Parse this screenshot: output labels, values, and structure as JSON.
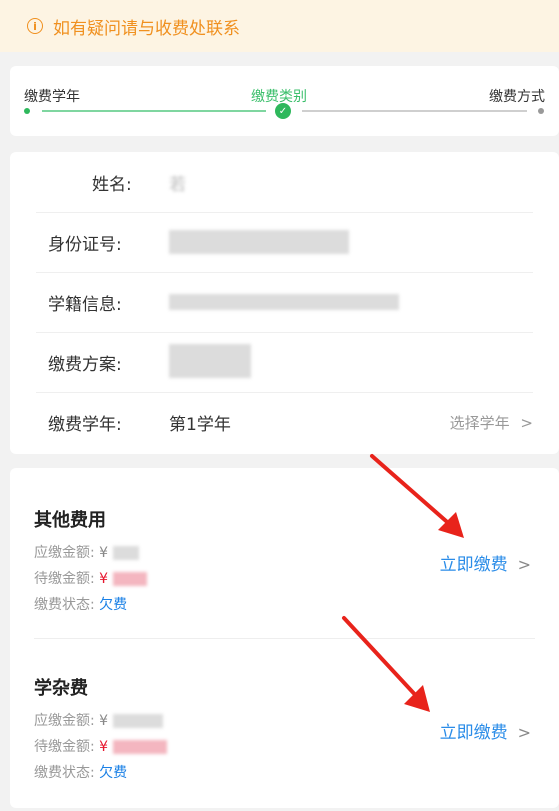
{
  "notice": {
    "icon": "info-icon",
    "text": "如有疑问请与收费处联系",
    "color": "#f0901f"
  },
  "steps": [
    {
      "label": "缴费学年"
    },
    {
      "label": "缴费类别",
      "active": true
    },
    {
      "label": "缴费方式"
    }
  ],
  "student": {
    "name_label": "姓名:",
    "name_value": "若",
    "id_label": "身份证号:",
    "status_label": "学籍信息:",
    "plan_label": "缴费方案:",
    "year_label": "缴费学年:",
    "year_value": "第1学年",
    "select_year": "选择学年"
  },
  "fees": [
    {
      "title": "其他费用",
      "due_label": "应缴金额:",
      "due_currency": "¥",
      "pending_label": "待缴金额:",
      "pending_currency": "¥",
      "status_label": "缴费状态:",
      "status_value": "欠费",
      "action": "立即缴费"
    },
    {
      "title": "学杂费",
      "due_label": "应缴金额:",
      "due_currency": "¥",
      "pending_label": "待缴金额:",
      "pending_currency": "¥",
      "status_label": "缴费状态:",
      "status_value": "欠费",
      "action": "立即缴费"
    }
  ],
  "colors": {
    "accent_green": "#3bbf6b",
    "link_blue": "#2a8ce8",
    "alert_red": "#e6162d",
    "annotation_arrow": "#e8231b"
  }
}
